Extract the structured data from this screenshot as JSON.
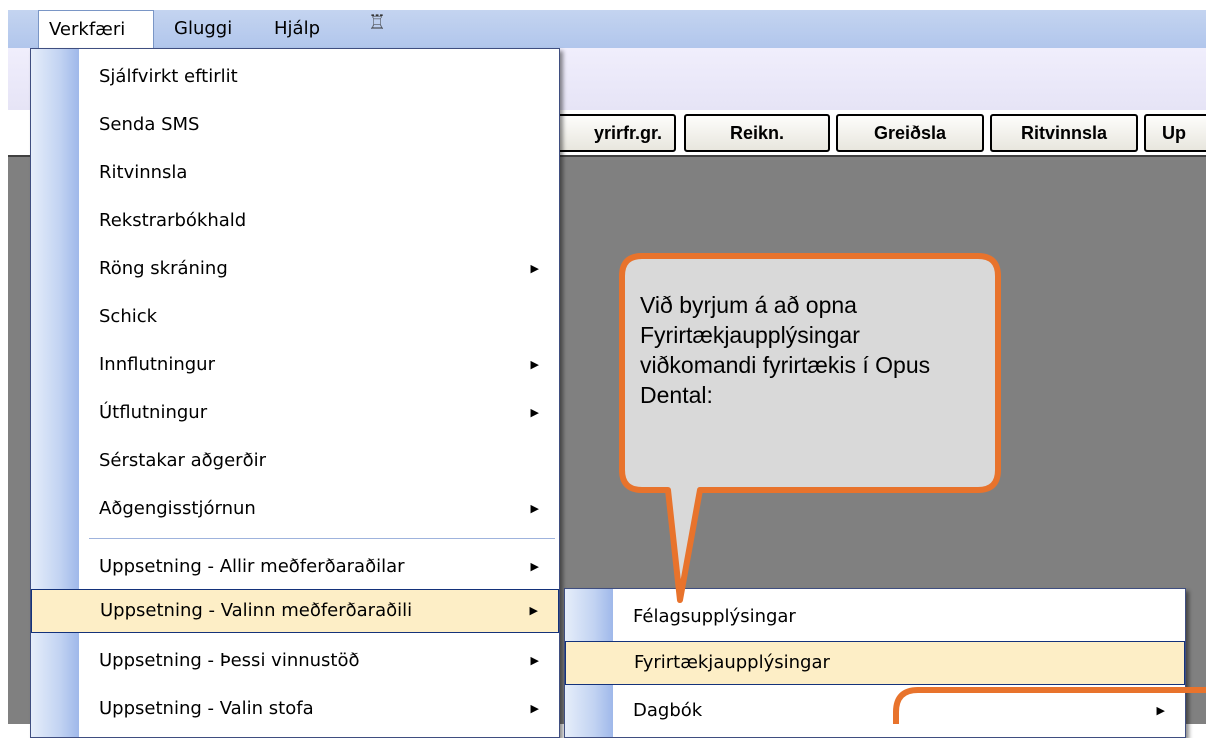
{
  "menubar": {
    "items": [
      {
        "label": "Verkfæri",
        "active": true
      },
      {
        "label": "Gluggi",
        "active": false
      },
      {
        "label": "Hjálp",
        "active": false
      }
    ],
    "app_icon": "help-figure-icon"
  },
  "toolbar": {
    "buttons": [
      "yrirfr.gr.",
      "Reikn.",
      "Greiðsla",
      "Ritvinnsla",
      "Up"
    ]
  },
  "tools_menu": {
    "items": [
      {
        "label": "Sjálfvirkt eftirlit",
        "submenu": false
      },
      {
        "label": "Senda SMS",
        "submenu": false
      },
      {
        "label": "Ritvinnsla",
        "submenu": false
      },
      {
        "label": "Rekstrarbókhald",
        "submenu": false
      },
      {
        "label": "Röng skráning",
        "submenu": true
      },
      {
        "label": "Schick",
        "submenu": false
      },
      {
        "label": "Innflutningur",
        "submenu": true
      },
      {
        "label": "Útflutningur",
        "submenu": true
      },
      {
        "label": "Sérstakar aðgerðir",
        "submenu": false
      },
      {
        "label": "Aðgengisstjórnun",
        "submenu": true
      },
      {
        "label": "Uppsetning - Allir meðferðaraðilar",
        "submenu": true
      },
      {
        "label": "Uppsetning - Valinn meðferðaraðili",
        "submenu": true
      },
      {
        "label": "Uppsetning - Þessi vinnustöð",
        "submenu": true
      },
      {
        "label": "Uppsetning - Valin stofa",
        "submenu": true
      }
    ]
  },
  "submenu": {
    "items": [
      {
        "label": "Félagsupplýsingar",
        "submenu": false
      },
      {
        "label": "Fyrirtækjaupplýsingar",
        "submenu": false
      },
      {
        "label": "Dagbók",
        "submenu": true
      }
    ]
  },
  "callout": {
    "text": "Við byrjum á að opna Fyrirtækjaupplýsingar viðkomandi fyrirtækis í Opus Dental:"
  },
  "colors": {
    "menubar": "#b8cbee",
    "workspace": "#808080",
    "highlight": "#fdeec6",
    "callout_fill": "#d9d9d9",
    "callout_border": "#e8732c"
  }
}
